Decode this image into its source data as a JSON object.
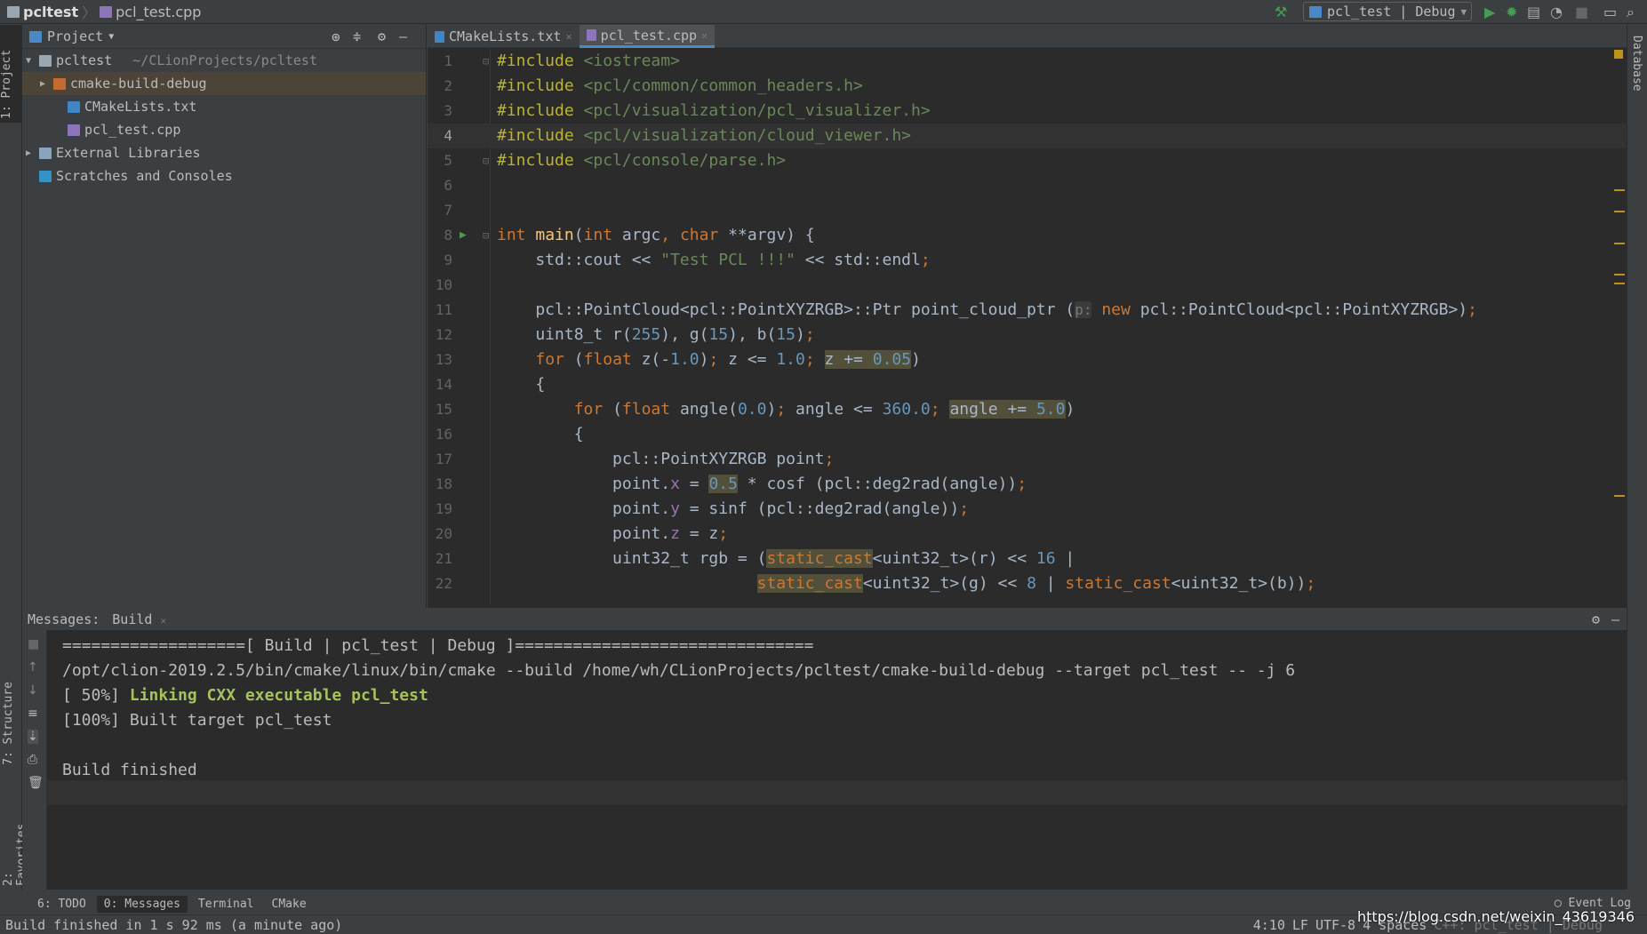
{
  "titlebar": {
    "project": "pcltest",
    "file": "pcl_test.cpp",
    "run_config": "pcl_test | Debug"
  },
  "left_strip": {
    "project_tab": "1: Project",
    "structure_tab": "7: Structure",
    "favorites_tab": "2: Favorites"
  },
  "right_strip": {
    "database_tab": "Database"
  },
  "project_panel": {
    "title": "Project",
    "tree": [
      {
        "label": "pcltest",
        "hint": "~/CLionProjects/pcltest",
        "icon": "folder-icon",
        "indent": 0,
        "arrow": "▼"
      },
      {
        "label": "cmake-build-debug",
        "icon": "folder-orange-icon",
        "indent": 1,
        "arrow": "▶",
        "selected": true
      },
      {
        "label": "CMakeLists.txt",
        "icon": "cmake-icon",
        "indent": 2,
        "arrow": ""
      },
      {
        "label": "pcl_test.cpp",
        "icon": "cpp-file-icon",
        "indent": 2,
        "arrow": ""
      },
      {
        "label": "External Libraries",
        "icon": "library-icon",
        "indent": 0,
        "arrow": "▶"
      },
      {
        "label": "Scratches and Consoles",
        "icon": "scratches-icon",
        "indent": 0,
        "arrow": ""
      }
    ]
  },
  "editor": {
    "tabs": [
      {
        "label": "CMakeLists.txt",
        "active": false
      },
      {
        "label": "pcl_test.cpp",
        "active": true
      }
    ],
    "current_line": 4,
    "lines": [
      [
        [
          "#include ",
          "inc"
        ],
        [
          "<iostream>",
          "str"
        ]
      ],
      [
        [
          "#include ",
          "inc"
        ],
        [
          "<pcl/common/common_headers.h>",
          "str"
        ]
      ],
      [
        [
          "#include ",
          "inc"
        ],
        [
          "<pcl/visualization/pcl_visualizer.h>",
          "str"
        ]
      ],
      [
        [
          "#include ",
          "inc"
        ],
        [
          "<pcl/visualization/cloud_viewer.h>",
          "str"
        ]
      ],
      [
        [
          "#include ",
          "inc"
        ],
        [
          "<pcl/console/parse.h>",
          "str"
        ]
      ],
      [],
      [],
      [
        [
          "int ",
          "kw"
        ],
        [
          "main",
          "fn"
        ],
        [
          "(",
          ""
        ],
        [
          "int ",
          "kw"
        ],
        [
          "argc",
          ""
        ],
        [
          ", ",
          "kw"
        ],
        [
          "char ",
          "kw"
        ],
        [
          "**argv) {",
          ""
        ]
      ],
      [
        [
          "    std::cout ",
          ""
        ],
        [
          "<< ",
          "op"
        ],
        [
          "\"Test PCL !!!\"",
          "str"
        ],
        [
          " << std::endl",
          ""
        ],
        [
          ";",
          "kw"
        ]
      ],
      [],
      [
        [
          "    pcl::PointCloud<pcl::PointXYZRGB>::Ptr point_cloud_ptr (",
          ""
        ],
        [
          "p:",
          "hint"
        ],
        [
          " ",
          ""
        ],
        [
          "new ",
          "kw"
        ],
        [
          "pcl::PointCloud<pcl::PointXYZRGB>)",
          ""
        ],
        [
          ";",
          "kw"
        ]
      ],
      [
        [
          "    uint8_t r(",
          ""
        ],
        [
          "255",
          "n"
        ],
        [
          "), g(",
          ""
        ],
        [
          "15",
          "n"
        ],
        [
          "), b(",
          ""
        ],
        [
          "15",
          "n"
        ],
        [
          ")",
          ""
        ],
        [
          ";",
          "kw"
        ]
      ],
      [
        [
          "    ",
          ""
        ],
        [
          "for ",
          "kw"
        ],
        [
          "(",
          ""
        ],
        [
          "float ",
          "kw"
        ],
        [
          "z(-",
          ""
        ],
        [
          "1.0",
          "n"
        ],
        [
          ")",
          ""
        ],
        [
          "; ",
          "kw"
        ],
        [
          "z <= ",
          ""
        ],
        [
          "1.0",
          "n"
        ],
        [
          "; ",
          "kw"
        ],
        [
          "z += ",
          "hl"
        ],
        [
          "0.05",
          "n hl"
        ],
        [
          ")",
          ""
        ]
      ],
      [
        [
          "    {",
          ""
        ]
      ],
      [
        [
          "        ",
          ""
        ],
        [
          "for ",
          "kw"
        ],
        [
          "(",
          ""
        ],
        [
          "float ",
          "kw"
        ],
        [
          "angle(",
          ""
        ],
        [
          "0.0",
          "n"
        ],
        [
          ")",
          ""
        ],
        [
          "; ",
          "kw"
        ],
        [
          "angle <= ",
          ""
        ],
        [
          "360.0",
          "n"
        ],
        [
          "; ",
          "kw"
        ],
        [
          "angle += ",
          "hl"
        ],
        [
          "5.0",
          "n hl"
        ],
        [
          ")",
          ""
        ]
      ],
      [
        [
          "        {",
          ""
        ]
      ],
      [
        [
          "            pcl::PointXYZRGB point",
          ""
        ],
        [
          ";",
          "kw"
        ]
      ],
      [
        [
          "            point.",
          ""
        ],
        [
          "x",
          "fld"
        ],
        [
          " = ",
          ""
        ],
        [
          "0.5",
          "n hl"
        ],
        [
          " * cosf (pcl::deg2rad(angle))",
          ""
        ],
        [
          ";",
          "kw"
        ]
      ],
      [
        [
          "            point.",
          ""
        ],
        [
          "y",
          "fld"
        ],
        [
          " = sinf (pcl::deg2rad(angle))",
          ""
        ],
        [
          ";",
          "kw"
        ]
      ],
      [
        [
          "            point.",
          ""
        ],
        [
          "z",
          "fld"
        ],
        [
          " = z",
          ""
        ],
        [
          ";",
          "kw"
        ]
      ],
      [
        [
          "            uint32_t rgb = (",
          ""
        ],
        [
          "static_cast",
          "kw hl"
        ],
        [
          "<uint32_t>(r) << ",
          ""
        ],
        [
          "16",
          "n"
        ],
        [
          " |",
          ""
        ]
      ],
      [
        [
          "                           ",
          ""
        ],
        [
          "static_cast",
          "kw hl"
        ],
        [
          "<uint32_t>(g) << ",
          ""
        ],
        [
          "8",
          "n"
        ],
        [
          " | ",
          ""
        ],
        [
          "static_cast",
          "kw"
        ],
        [
          "<uint32_t>(b))",
          ""
        ],
        [
          ";",
          "kw"
        ]
      ]
    ]
  },
  "messages": {
    "title": "Messages:",
    "tab": "Build",
    "lines": [
      {
        "text": "===================[ Build | pcl_test | Debug ]===============================",
        "style": ""
      },
      {
        "text": "/opt/clion-2019.2.5/bin/cmake/linux/bin/cmake --build /home/wh/CLionProjects/pcltest/cmake-build-debug --target pcl_test -- -j 6",
        "style": ""
      },
      {
        "text": "[ 50%] ",
        "style": "",
        "bold": "Linking CXX executable pcl_test"
      },
      {
        "text": "[100%] Built target pcl_test",
        "style": ""
      },
      {
        "text": "",
        "style": ""
      },
      {
        "text": "Build finished",
        "style": ""
      }
    ]
  },
  "bottom_tabs": [
    {
      "label": "6: TODO",
      "active": false
    },
    {
      "label": "0: Messages",
      "active": true
    },
    {
      "label": "Terminal",
      "active": false
    },
    {
      "label": "CMake",
      "active": false
    }
  ],
  "event_log": "Event Log",
  "status": {
    "message": "Build finished in 1 s 92 ms (a minute ago)",
    "position": "4:10",
    "line_sep": "LF",
    "encoding": "UTF-8",
    "indent": "4 spaces",
    "context": "C++: pcl_test | Debug"
  },
  "watermark": "https://blog.csdn.net/weixin_43619346",
  "colors": {
    "keyword": "#cc7832",
    "string": "#6a8759",
    "number": "#6897bb",
    "include": "#bbb529",
    "accent": "#4a88c7"
  }
}
